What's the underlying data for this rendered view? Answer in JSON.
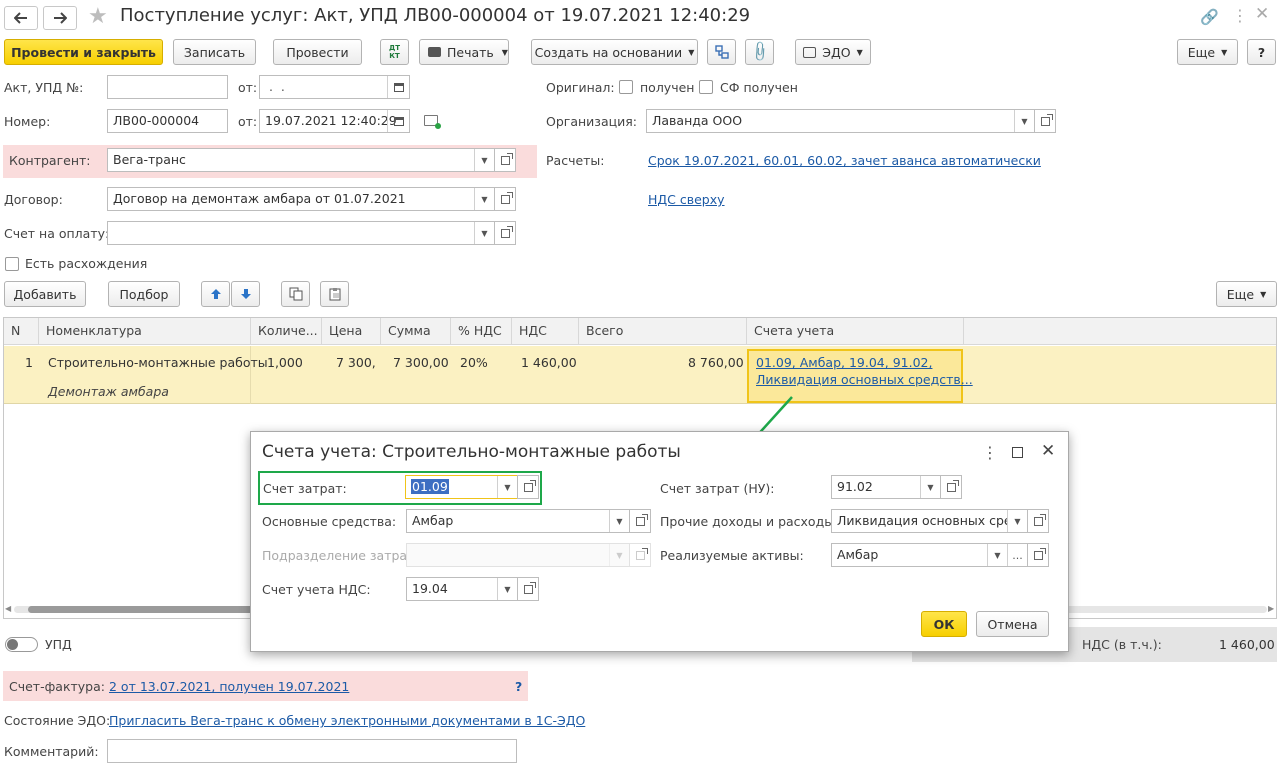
{
  "window": {
    "title": "Поступление услуг: Акт, УПД ЛВ00-000004 от 19.07.2021 12:40:29"
  },
  "toolbar": {
    "post_close": "Провести и закрыть",
    "save": "Записать",
    "post": "Провести",
    "dtkt": "ДТ КТ",
    "print": "Печать",
    "create_based": "Создать на основании",
    "edo": "ЭДО",
    "more": "Еще",
    "help": "?"
  },
  "form": {
    "act_label": "Акт, УПД №:",
    "from_label": "от:",
    "act_date_placeholder": " .  .",
    "number_label": "Номер:",
    "number_value": "ЛВ00-000004",
    "date_value": "19.07.2021 12:40:29",
    "original_label": "Оригинал:",
    "received_label": "получен",
    "sf_received_label": "СФ получен",
    "org_label": "Организация:",
    "org_value": "Лаванда ООО",
    "contractor_label": "Контрагент:",
    "contractor_value": "Вега-транс",
    "settlements_label": "Расчеты:",
    "settlements_link": "Срок 19.07.2021, 60.01, 60.02, зачет аванса автоматически",
    "contract_label": "Договор:",
    "contract_value": "Договор на демонтаж амбара от 01.07.2021",
    "vat_link": "НДС сверху",
    "invoice_pay_label": "Счет на оплату:",
    "discrepancy_label": "Есть расхождения"
  },
  "table_toolbar": {
    "add": "Добавить",
    "select": "Подбор",
    "more": "Еще"
  },
  "table": {
    "headers": [
      "N",
      "Номенклатура",
      "Количе...",
      "Цена",
      "Сумма",
      "% НДС",
      "НДС",
      "Всего",
      "Счета учета"
    ],
    "row": {
      "n": "1",
      "name": "Строительно-монтажные работы",
      "desc": "Демонтаж амбара",
      "qty": "1,000",
      "price": "7 300,",
      "sum": "7 300,00",
      "vat_rate": "20%",
      "vat": "1 460,00",
      "total": "8 760,00",
      "accounts_line1": "01.09, Амбар, 19.04, 91.02,",
      "accounts_line2": "Ликвидация основных средств..."
    }
  },
  "dialog": {
    "title": "Счета учета: Строительно-монтажные работы",
    "cost_account_label": "Счет затрат:",
    "cost_account_value": "01.09",
    "fixed_assets_label": "Основные средства:",
    "fixed_assets_value": "Амбар",
    "cost_dept_label": "Подразделение затрат:",
    "vat_account_label": "Счет учета НДС:",
    "vat_account_value": "19.04",
    "cost_account_nu_label": "Счет затрат (НУ):",
    "cost_account_nu_value": "91.02",
    "other_income_label": "Прочие доходы и расходы:",
    "other_income_value": "Ликвидация основных средств",
    "sold_assets_label": "Реализуемые активы:",
    "sold_assets_value": "Амбар",
    "ellipsis": "...",
    "ok": "ОК",
    "cancel": "Отмена"
  },
  "footer": {
    "upd_label": "УПД",
    "vat_incl_label": "НДС (в т.ч.):",
    "vat_incl_value": "1 460,00",
    "invoice_label": "Счет-фактура:",
    "invoice_link": "2 от 13.07.2021, получен 19.07.2021",
    "question": "?",
    "edo_state_label": "Состояние ЭДО:",
    "edo_link": "Пригласить Вега-транс к обмену электронными документами в 1С-ЭДО",
    "comment_label": "Комментарий:"
  },
  "colors": {
    "accent": "#f7cf00",
    "highlight_row": "#fbf1c2",
    "required": "#fadcdc",
    "link": "#1c5aa6",
    "green": "#1ea84a"
  }
}
